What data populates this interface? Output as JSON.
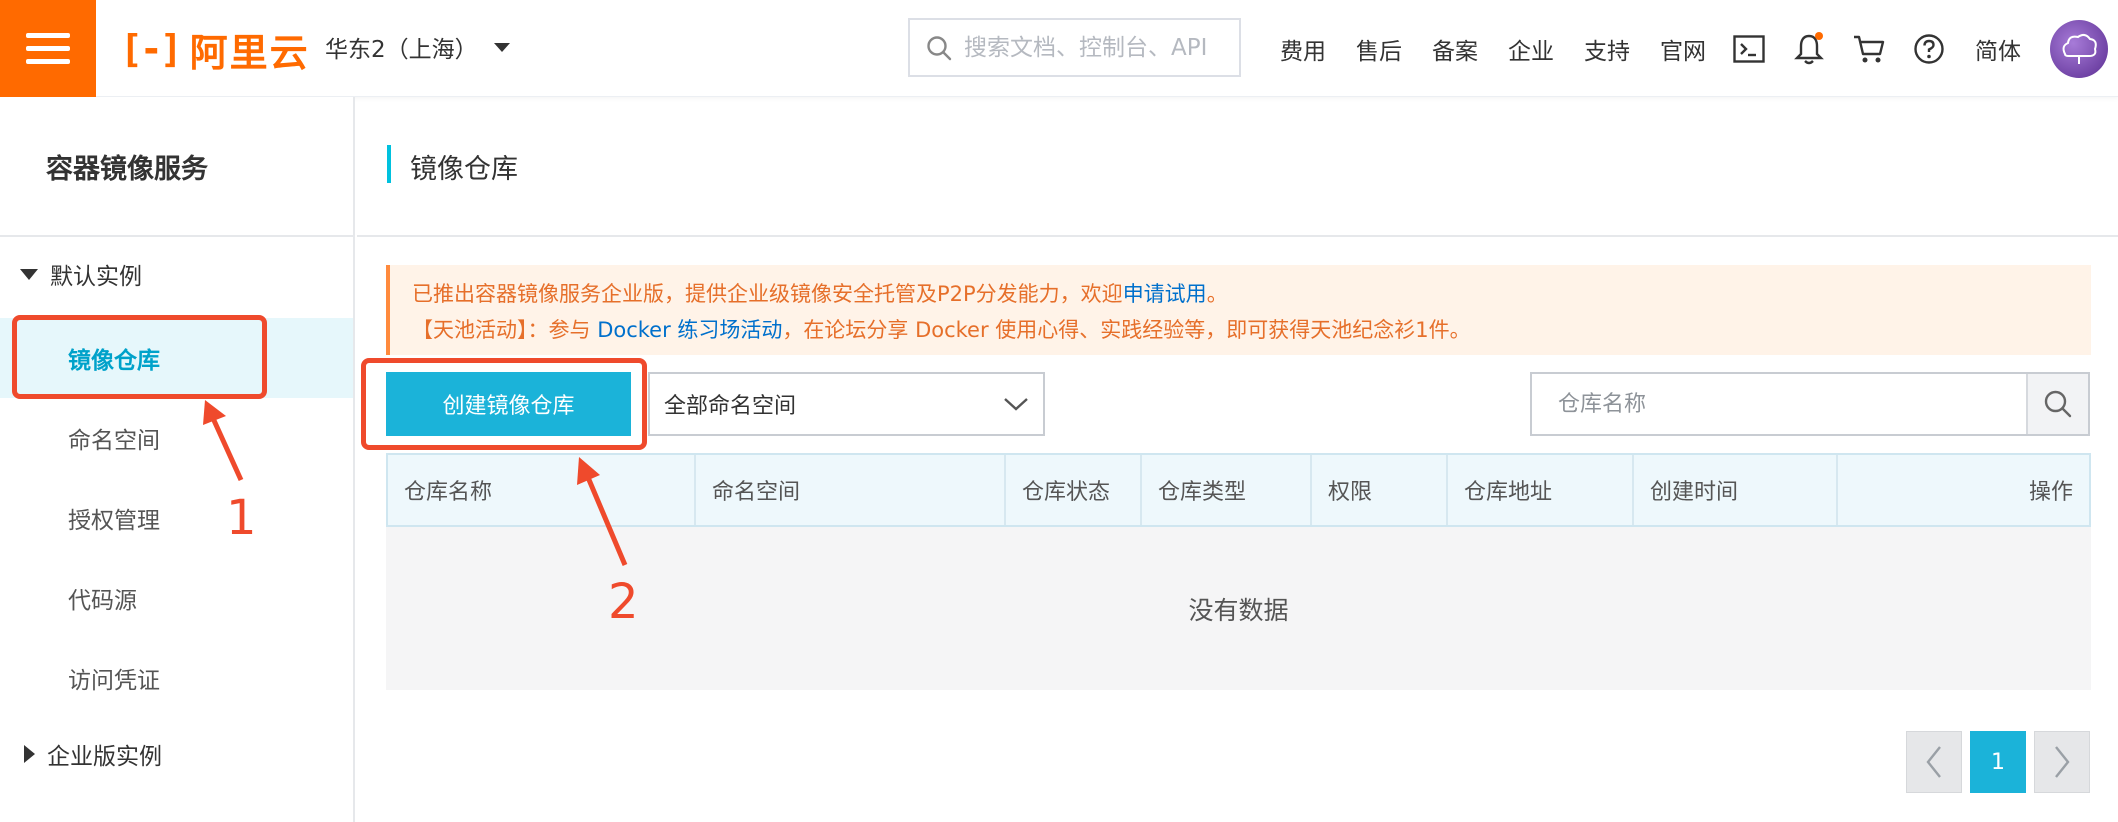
{
  "topbar": {
    "logo_text": "阿里云",
    "region": "华东2（上海）",
    "search_placeholder": "搜索文档、控制台、API",
    "links": [
      "费用",
      "售后",
      "备案",
      "企业",
      "支持",
      "官网"
    ],
    "icons": [
      "terminal-icon",
      "bell-icon",
      "cart-icon",
      "help-icon"
    ],
    "language": "简体",
    "brand_color": "#ff6a00"
  },
  "sidebar": {
    "title": "容器镜像服务",
    "group_default": "默认实例",
    "items": [
      {
        "label": "镜像仓库",
        "active": true
      },
      {
        "label": "命名空间",
        "active": false
      },
      {
        "label": "授权管理",
        "active": false
      },
      {
        "label": "代码源",
        "active": false
      },
      {
        "label": "访问凭证",
        "active": false
      }
    ],
    "group_enterprise": "企业版实例"
  },
  "main": {
    "title": "镜像仓库",
    "notice": {
      "line1_text": "已推出容器镜像服务企业版，提供企业级镜像安全托管及P2P分发能力，欢迎",
      "line1_link": "申请试用",
      "line1_end": "。",
      "line2_prefix": "【天池活动】：参与 ",
      "line2_link": "Docker 练习场活动",
      "line2_suffix": "，在论坛分享 Docker 使用心得、实践经验等，即可获得天池纪念衫1件。"
    },
    "create_button": "创建镜像仓库",
    "namespace_select": "全部命名空间",
    "repo_search_placeholder": "仓库名称",
    "table": {
      "columns": [
        "仓库名称",
        "命名空间",
        "仓库状态",
        "仓库类型",
        "权限",
        "仓库地址",
        "创建时间",
        "操作"
      ],
      "empty_text": "没有数据"
    },
    "pagination": {
      "current": "1"
    }
  },
  "annotations": {
    "label1": "1",
    "label2": "2",
    "color": "#ef4a2c"
  }
}
